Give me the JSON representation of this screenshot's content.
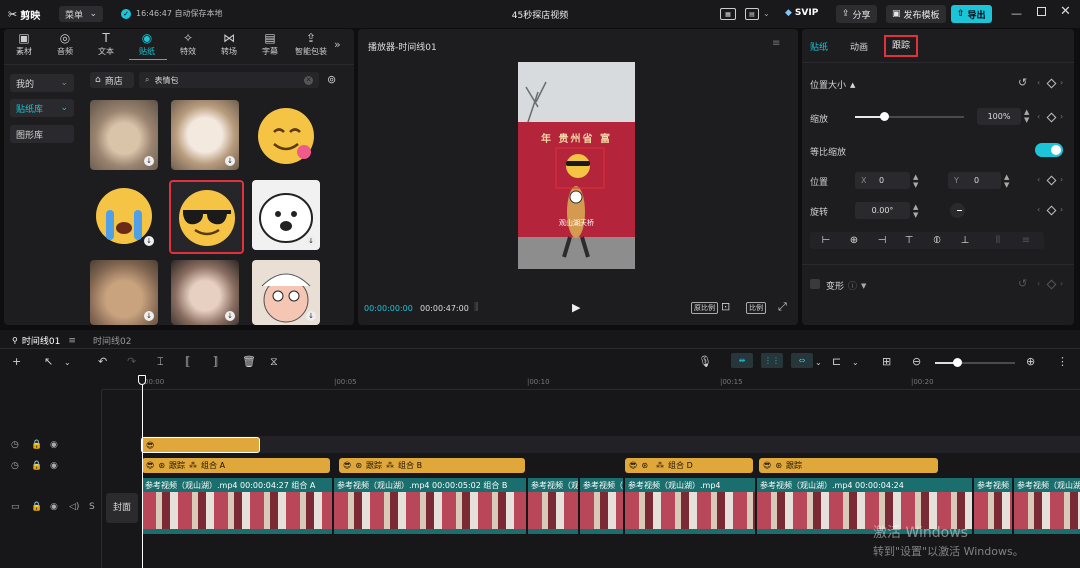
{
  "app": {
    "logo_text": "剪映",
    "menu_label": "菜单",
    "autosave": "16:46:47 自动保存本地",
    "project_title": "45秒探店视频"
  },
  "titlebar": {
    "svip": "SVIP",
    "share": "分享",
    "publish": "发布模板",
    "export": "导出"
  },
  "tools": [
    "素材",
    "音频",
    "文本",
    "贴纸",
    "特效",
    "转场",
    "字幕",
    "智能包装"
  ],
  "sticker_panel": {
    "side_items": [
      "我的",
      "贴纸库",
      "图形库"
    ],
    "store_label": "商店",
    "search_value": "表情包"
  },
  "player": {
    "title": "播放器-时间线01",
    "time_current": "00:00:00:00",
    "time_total": "00:00:47:00",
    "ratio_label": "原比例",
    "frame_label": "比例"
  },
  "video_text": {
    "banner": "年 贵州省 富",
    "sub": "观山湖天桥"
  },
  "inspector": {
    "tabs": [
      "贴纸",
      "动画",
      "跟踪"
    ],
    "section_title": "位置大小",
    "scale_label": "缩放",
    "scale_value": "100%",
    "scale_fraction": 0.27,
    "uniform_label": "等比缩放",
    "position_label": "位置",
    "x_label": "X",
    "x_value": "0",
    "y_label": "Y",
    "y_value": "0",
    "rotate_label": "旋转",
    "rotate_value": "0.00°",
    "transform_label": "变形"
  },
  "timeline": {
    "tabs": [
      "时间线01",
      "时间线02"
    ],
    "ruler": [
      "00:00",
      "|00:05",
      "|00:10",
      "|00:15",
      "|00:20"
    ],
    "cover_label": "封面",
    "s_label": "S",
    "effect_clips": [
      {
        "text": "跟踪",
        "group": "组合 A"
      },
      {
        "text": "跟踪",
        "group": "组合 B"
      },
      {
        "text": "",
        "group": "组合 D"
      },
      {
        "text": "跟踪",
        "group": ""
      }
    ],
    "video_clips": [
      {
        "label": "参考视频（观山湖）.mp4  00:00:04:27  组合 A"
      },
      {
        "label": "参考视频（观山湖）.mp4  00:00:05:02  组合 B"
      },
      {
        "label": "参考视频（观"
      },
      {
        "label": "参考视频（"
      },
      {
        "label": "参考视频（观山湖）.mp4"
      },
      {
        "label": "参考视频（观山湖）.mp4  00:00:04:24"
      },
      {
        "label": "参考视频（观山湖）.mp4"
      },
      {
        "label": "参考视频（观山湖）.mp4  00:00:0"
      }
    ]
  },
  "watermark": {
    "line1": "激活 Windows",
    "line2": "转到\"设置\"以激活 Windows。"
  },
  "colors": {
    "accent": "#1bc4d6",
    "highlight_border": "#e0323c",
    "clip_yellow": "#e0a73a",
    "video_teal": "#1a6e6e"
  }
}
